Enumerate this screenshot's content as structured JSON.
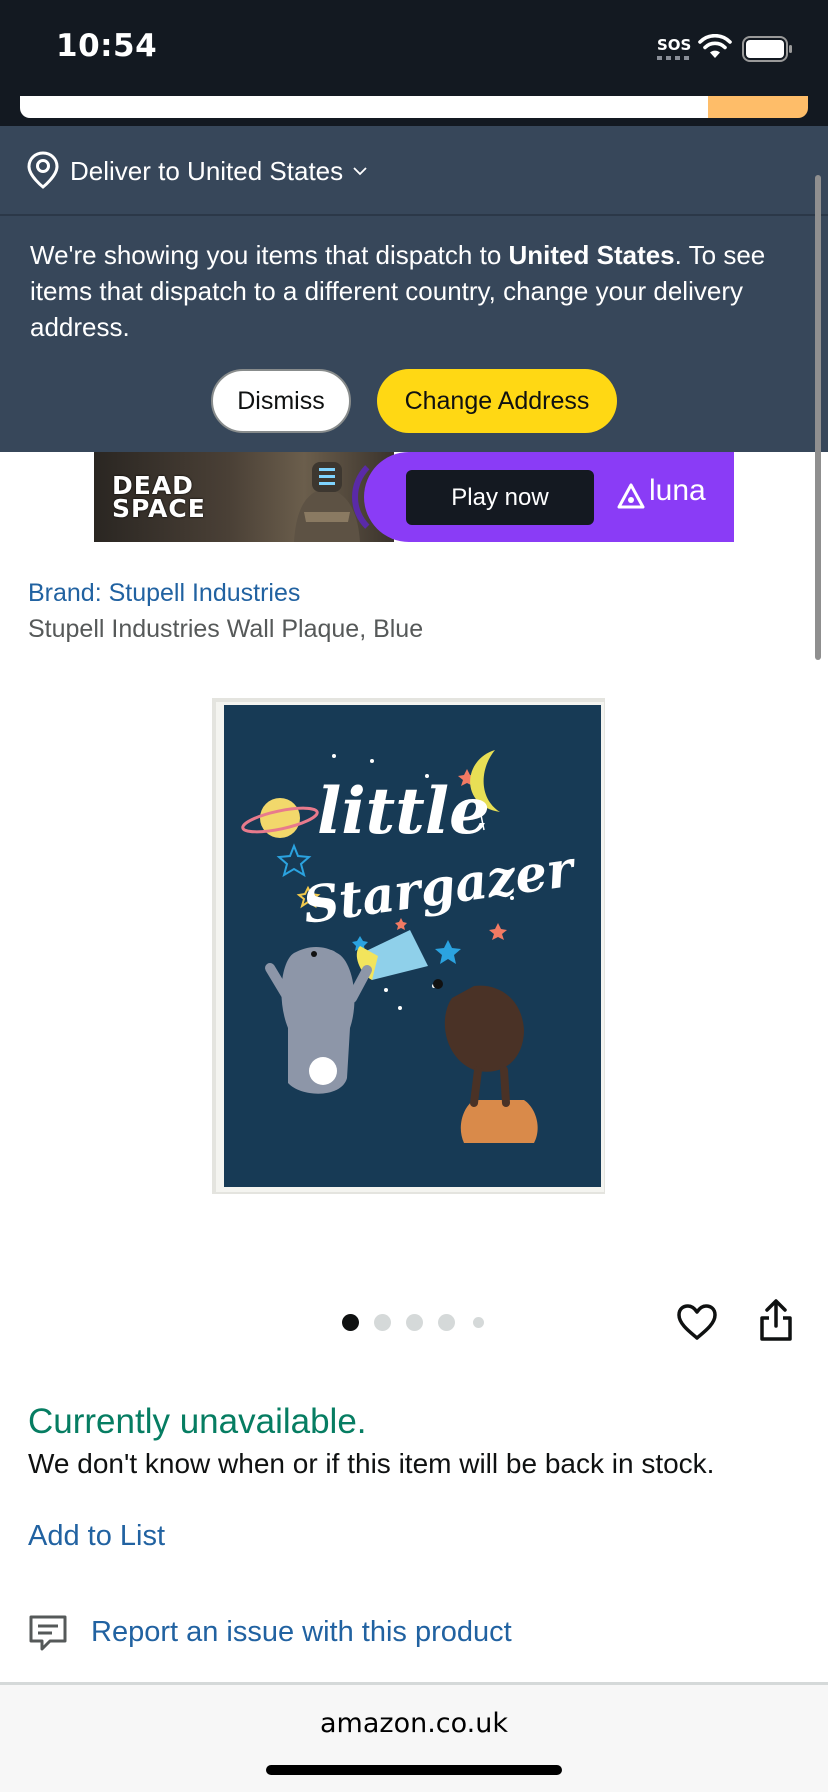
{
  "status_bar": {
    "time": "10:54",
    "sos": "SOS",
    "icons": [
      "wifi-icon",
      "battery-icon"
    ]
  },
  "delivery": {
    "label": "Deliver to United States"
  },
  "notice": {
    "text_before": "We're showing you items that dispatch to ",
    "text_bold": "United States",
    "text_after": ". To see items that dispatch to a different country, change your delivery address.",
    "dismiss_label": "Dismiss",
    "change_address_label": "Change Address"
  },
  "ad": {
    "game_title_line1": "DEAD",
    "game_title_line2": "SPACE",
    "play_label": "Play now",
    "brand": "luna"
  },
  "product": {
    "brand_link": "Brand: Stupell Industries",
    "title": "Stupell Industries Wall Plaque, Blue",
    "image_text_line1": "little",
    "image_text_line2": "Stargazer",
    "image_count": 5,
    "active_image_index": 0
  },
  "availability": {
    "status": "Currently unavailable.",
    "note": "We don't know when or if this item will be back in stock.",
    "add_to_list": "Add to List",
    "report_link": "Report an issue with this product"
  },
  "browser": {
    "url": "amazon.co.uk"
  },
  "colors": {
    "header_dark": "#131921",
    "deliver_bar": "#37475a",
    "accent_yellow": "#ffd814",
    "search_orange": "#febd69",
    "link_blue": "#2162a1",
    "availability_green": "#067d62",
    "ad_purple": "#8a3cf6",
    "plaque_navy": "#173a55"
  }
}
